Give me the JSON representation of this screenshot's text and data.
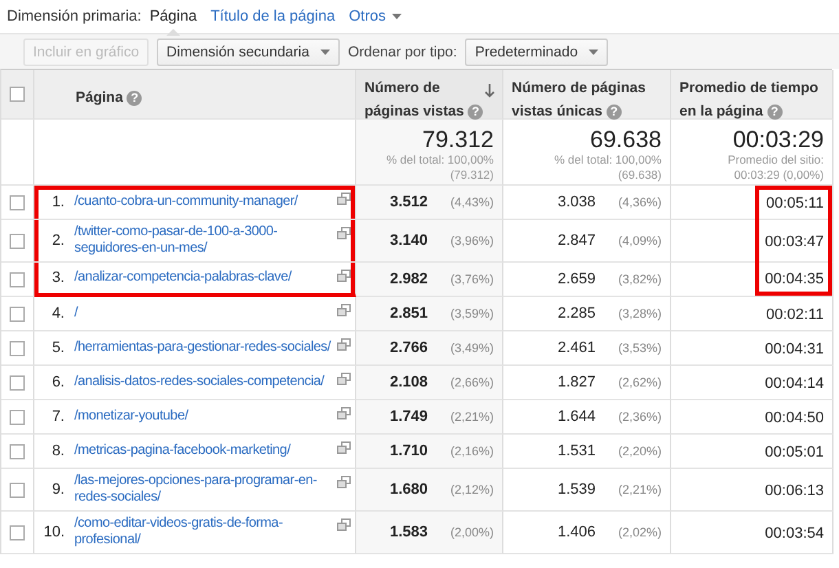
{
  "primary_dimension": {
    "label": "Dimensión primaria:",
    "options": [
      {
        "label": "Página",
        "selected": true
      },
      {
        "label": "Título de la página",
        "selected": false
      },
      {
        "label": "Otros",
        "selected": false,
        "dropdown": true
      }
    ]
  },
  "toolbar": {
    "chart_button": {
      "label": "Incluir en gráfico",
      "disabled": true
    },
    "secondary_dimension": "Dimensión secundaria",
    "sort_label": "Ordenar por tipo:",
    "sort_select": "Predeterminado"
  },
  "table": {
    "select_all": {
      "checked": false
    },
    "columns": [
      {
        "label": "Página",
        "help": "?",
        "sorted": false
      },
      {
        "label": "Número de páginas vistas",
        "help": "?",
        "sorted": true
      },
      {
        "label": "Número de páginas vistas únicas",
        "help": "?",
        "sorted": false
      },
      {
        "label": "Promedio de tiempo en la página",
        "help": "?",
        "sorted": false
      }
    ],
    "totals": [
      {
        "value": "79.312",
        "note": "% del total: 100,00% (79.312)"
      },
      {
        "value": "69.638",
        "note": "% del total: 100,00% (69.638)"
      },
      {
        "value": "00:03:29",
        "note": "Promedio del sitio: 00:03:29 (0,00%)"
      }
    ],
    "rows": [
      {
        "checked": false,
        "highlighted": true,
        "index": "1.",
        "page": "/cuanto-cobra-un-community-manager/",
        "views": "3.512",
        "views_pct": "(4,43%)",
        "unique": "3.038",
        "unique_pct": "(4,36%)",
        "time": "00:05:11"
      },
      {
        "checked": false,
        "highlighted": true,
        "index": "2.",
        "page": "/twitter-como-pasar-de-100-a-3000-seguidores-en-un-mes/",
        "views": "3.140",
        "views_pct": "(3,96%)",
        "unique": "2.847",
        "unique_pct": "(4,09%)",
        "time": "00:03:47"
      },
      {
        "checked": false,
        "highlighted": true,
        "index": "3.",
        "page": "/analizar-competencia-palabras-clave/",
        "views": "2.982",
        "views_pct": "(3,76%)",
        "unique": "2.659",
        "unique_pct": "(3,82%)",
        "time": "00:04:35"
      },
      {
        "checked": false,
        "highlighted": false,
        "index": "4.",
        "page": "/",
        "views": "2.851",
        "views_pct": "(3,59%)",
        "unique": "2.285",
        "unique_pct": "(3,28%)",
        "time": "00:02:11"
      },
      {
        "checked": false,
        "highlighted": false,
        "index": "5.",
        "page": "/herramientas-para-gestionar-redes-sociales/",
        "views": "2.766",
        "views_pct": "(3,49%)",
        "unique": "2.461",
        "unique_pct": "(3,53%)",
        "time": "00:04:31"
      },
      {
        "checked": false,
        "highlighted": false,
        "index": "6.",
        "page": "/analisis-datos-redes-sociales-competencia/",
        "views": "2.108",
        "views_pct": "(2,66%)",
        "unique": "1.827",
        "unique_pct": "(2,62%)",
        "time": "00:04:14"
      },
      {
        "checked": false,
        "highlighted": false,
        "index": "7.",
        "page": "/monetizar-youtube/",
        "views": "1.749",
        "views_pct": "(2,21%)",
        "unique": "1.644",
        "unique_pct": "(2,36%)",
        "time": "00:04:50"
      },
      {
        "checked": false,
        "highlighted": false,
        "index": "8.",
        "page": "/metricas-pagina-facebook-marketing/",
        "views": "1.710",
        "views_pct": "(2,16%)",
        "unique": "1.531",
        "unique_pct": "(2,20%)",
        "time": "00:05:01"
      },
      {
        "checked": false,
        "highlighted": false,
        "index": "9.",
        "page": "/las-mejores-opciones-para-programar-en-redes-sociales/",
        "views": "1.680",
        "views_pct": "(2,12%)",
        "unique": "1.539",
        "unique_pct": "(2,21%)",
        "time": "00:06:13"
      },
      {
        "checked": false,
        "highlighted": false,
        "index": "10.",
        "page": "/como-editar-videos-gratis-de-forma-profesional/",
        "views": "1.583",
        "views_pct": "(2,00%)",
        "unique": "1.406",
        "unique_pct": "(2,02%)",
        "time": "00:03:54"
      }
    ]
  }
}
